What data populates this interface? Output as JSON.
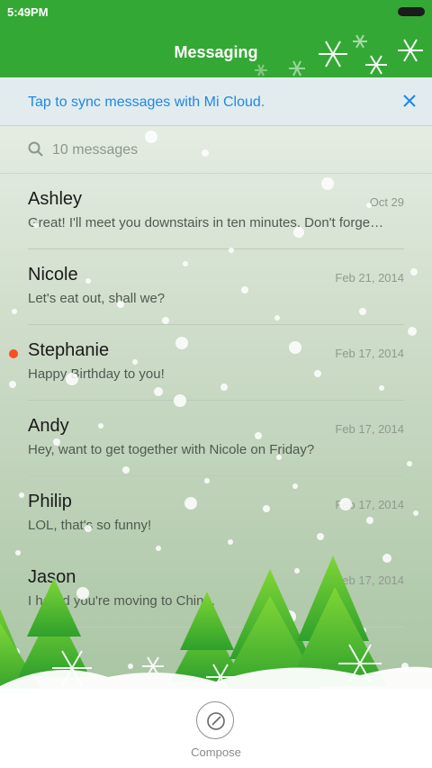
{
  "status_bar": {
    "time": "5:49PM"
  },
  "header": {
    "title": "Messaging"
  },
  "sync_banner": {
    "text": "Tap to sync messages with Mi Cloud.",
    "close_icon": "close-icon",
    "accent_color": "#1e88e5"
  },
  "search": {
    "placeholder": "10 messages",
    "icon": "search-icon"
  },
  "messages": [
    {
      "name": "Ashley",
      "date": "Oct 29",
      "preview": "Great! I'll meet you downstairs in ten minutes. Don't forge…",
      "unread": false
    },
    {
      "name": "Nicole",
      "date": "Feb 21, 2014",
      "preview": "Let's eat out, shall we?",
      "unread": false
    },
    {
      "name": "Stephanie",
      "date": "Feb 17, 2014",
      "preview": "Happy Birthday to you!",
      "unread": true
    },
    {
      "name": "Andy",
      "date": "Feb 17, 2014",
      "preview": "Hey, want to get together with Nicole on Friday?",
      "unread": false
    },
    {
      "name": "Philip",
      "date": "Feb 17, 2014",
      "preview": "LOL, that's so funny!",
      "unread": false
    },
    {
      "name": "Jason",
      "date": "Feb 17, 2014",
      "preview": "I heard you're moving to China.",
      "unread": false
    }
  ],
  "bottom_bar": {
    "compose_label": "Compose",
    "compose_icon": "compose-icon"
  },
  "colors": {
    "header_green": "#34a835",
    "unread_dot": "#f4511e"
  }
}
